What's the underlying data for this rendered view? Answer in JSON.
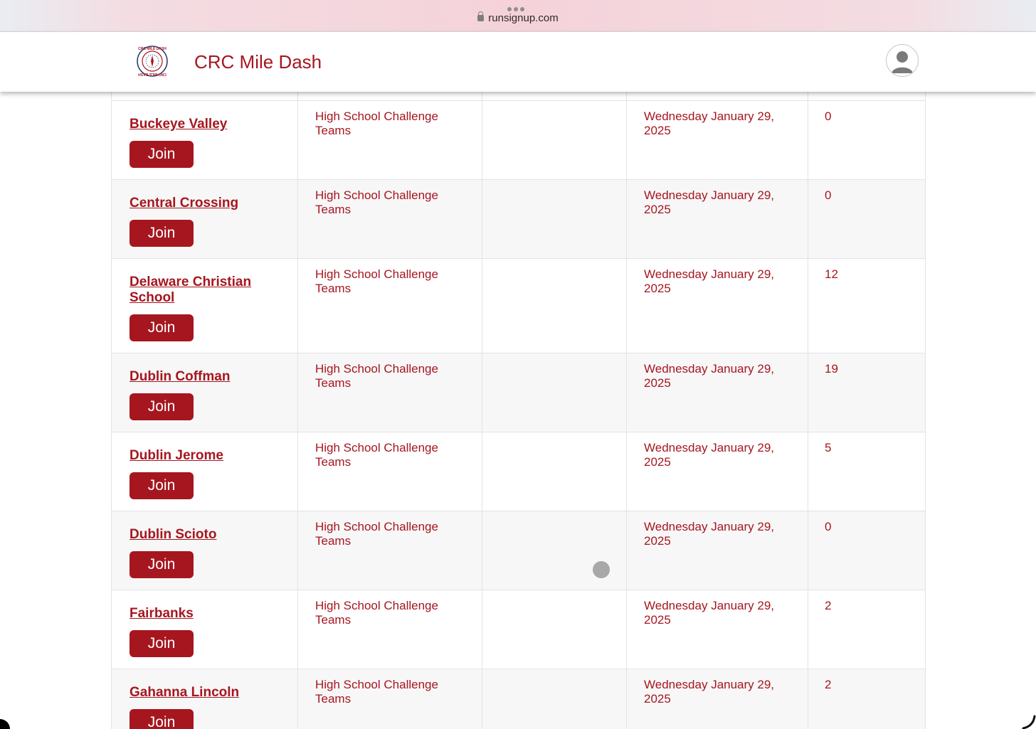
{
  "browser": {
    "url": "runsignup.com"
  },
  "header": {
    "site_title": "CRC Mile Dash",
    "logo_text_top": "CRC MILE DASH",
    "logo_text_bottom": "CRC MILE DASH"
  },
  "colors": {
    "accent": "#a6161f",
    "row_alt": "#f7f7f7",
    "border": "#e3e3e3"
  },
  "table": {
    "rows": [
      {
        "team": "Buckeye Valley",
        "category": "High School Challenge Teams",
        "date": "Wednesday January 29, 2025",
        "count": "0",
        "join_label": "Join"
      },
      {
        "team": "Central Crossing",
        "category": "High School Challenge Teams",
        "date": "Wednesday January 29, 2025",
        "count": "0",
        "join_label": "Join"
      },
      {
        "team": "Delaware Christian School",
        "category": "High School Challenge Teams",
        "date": "Wednesday January 29, 2025",
        "count": "12",
        "join_label": "Join"
      },
      {
        "team": "Dublin Coffman",
        "category": "High School Challenge Teams",
        "date": "Wednesday January 29, 2025",
        "count": "19",
        "join_label": "Join"
      },
      {
        "team": "Dublin Jerome",
        "category": "High School Challenge Teams",
        "date": "Wednesday January 29, 2025",
        "count": "5",
        "join_label": "Join"
      },
      {
        "team": "Dublin Scioto",
        "category": "High School Challenge Teams",
        "date": "Wednesday January 29, 2025",
        "count": "0",
        "join_label": "Join"
      },
      {
        "team": "Fairbanks",
        "category": "High School Challenge Teams",
        "date": "Wednesday January 29, 2025",
        "count": "2",
        "join_label": "Join"
      },
      {
        "team": "Gahanna Lincoln",
        "category": "High School Challenge Teams",
        "date": "Wednesday January 29, 2025",
        "count": "2",
        "join_label": "Join"
      }
    ]
  }
}
